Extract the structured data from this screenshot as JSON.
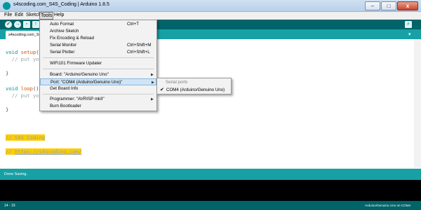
{
  "window": {
    "title": "s4scoding.com_S4S_Coding | Arduino 1.8.5",
    "min_label": "–",
    "max_label": "□",
    "close_label": "x"
  },
  "menu": {
    "file": "File",
    "edit": "Edit",
    "sketch": "Sketch",
    "tools": "Tools",
    "help": "Help"
  },
  "toolbar": {
    "verify": "✓",
    "upload": "→",
    "new": "▫",
    "open": "↑",
    "save": "↓",
    "serial_monitor": "⌕"
  },
  "tab": {
    "label": "s4scoding.com_S4S_Coding",
    "menu_button": "▾"
  },
  "editor": {
    "line1_kw": "void",
    "line1_fn": "setup",
    "line1_rest": "() {",
    "line2": "  // put your setup code here, to run once:",
    "line4": "}",
    "line6_kw": "void",
    "line6_fn": "loop",
    "line6_rest": "() {",
    "line7": "  // put your main code here, to run repeatedly:",
    "line9": "}",
    "comment1": "// S4S Coding",
    "comment2_prefix": "// ",
    "comment2_link": "https://s4scoding.com/"
  },
  "tools_menu": {
    "items": [
      {
        "label": "Auto Format",
        "shortcut": "Ctrl+T"
      },
      {
        "label": "Archive Sketch",
        "shortcut": ""
      },
      {
        "label": "Fix Encoding & Reload",
        "shortcut": ""
      },
      {
        "label": "Serial Monitor",
        "shortcut": "Ctrl+Shift+M"
      },
      {
        "label": "Serial Plotter",
        "shortcut": "Ctrl+Shift+L"
      },
      {
        "label": "WiFi101 Firmware Updater",
        "shortcut": ""
      },
      {
        "label": "Board: \"Arduino/Genuino Uno\"",
        "shortcut": ""
      },
      {
        "label": "Port: \"COM4 (Arduino/Genuino Uno)\"",
        "shortcut": ""
      },
      {
        "label": "Get Board Info",
        "shortcut": ""
      },
      {
        "label": "Programmer: \"AVRISP mkII\"",
        "shortcut": ""
      },
      {
        "label": "Burn Bootloader",
        "shortcut": ""
      }
    ]
  },
  "port_submenu": {
    "header": "Serial ports",
    "selected_port": "COM4 (Arduino/Genuino Uno)"
  },
  "status": {
    "message": "Done Saving.",
    "line_number": "14 - 19",
    "board_info": "Arduino/Genuino Uno on COM4"
  }
}
